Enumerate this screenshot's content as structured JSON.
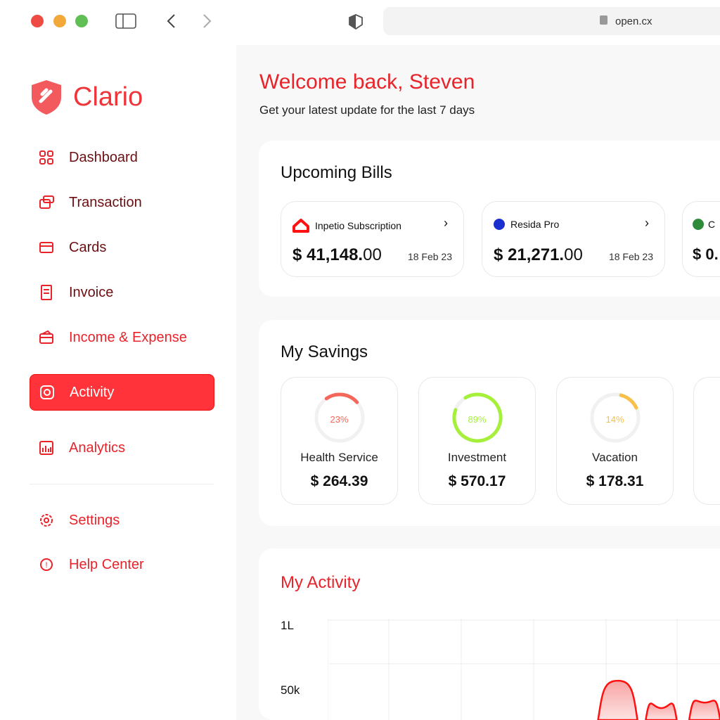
{
  "browser": {
    "url": "open.cx"
  },
  "brand": {
    "name": "Clario"
  },
  "sidebar": {
    "items": [
      {
        "label": "Dashboard"
      },
      {
        "label": "Transaction"
      },
      {
        "label": "Cards"
      },
      {
        "label": "Invoice"
      },
      {
        "label": "Income & Expense"
      },
      {
        "label": "Activity"
      },
      {
        "label": "Analytics"
      },
      {
        "label": "Settings"
      },
      {
        "label": "Help Center"
      }
    ]
  },
  "header": {
    "title": "Welcome back, Steven",
    "subtitle": "Get your latest update for the last 7 days"
  },
  "bills": {
    "title": "Upcoming Bills",
    "items": [
      {
        "name": "Inpetio Subscription",
        "amount_main": "$ 41,148.",
        "amount_cents": "00",
        "date": "18 Feb 23"
      },
      {
        "name": "Resida Pro",
        "amount_main": "$ 21,271.",
        "amount_cents": "00",
        "date": "18 Feb 23"
      },
      {
        "name": "C",
        "amount_main": "$ 0.",
        "amount_cents": "",
        "date": ""
      }
    ]
  },
  "savings": {
    "title": "My Savings",
    "items": [
      {
        "label": "Health Service",
        "value": "$ 264.39",
        "percent": 23,
        "pct_label": "23%",
        "color": "#f4675a"
      },
      {
        "label": "Investment",
        "value": "$ 570.17",
        "percent": 89,
        "pct_label": "89%",
        "color": "#a6f03c"
      },
      {
        "label": "Vacation",
        "value": "$ 178.31",
        "percent": 14,
        "pct_label": "14%",
        "color": "#f7c04a"
      }
    ]
  },
  "chart_data": {
    "type": "area",
    "title": "My Activity",
    "ytick_labels": [
      "1L",
      "50k"
    ],
    "ylim": [
      0,
      100000
    ],
    "series": [
      {
        "name": "activity",
        "peaks": [
          {
            "x": 4.2,
            "y": 42000
          },
          {
            "x": 4.8,
            "y": 22000
          },
          {
            "x": 5.4,
            "y": 26000
          }
        ]
      }
    ]
  }
}
